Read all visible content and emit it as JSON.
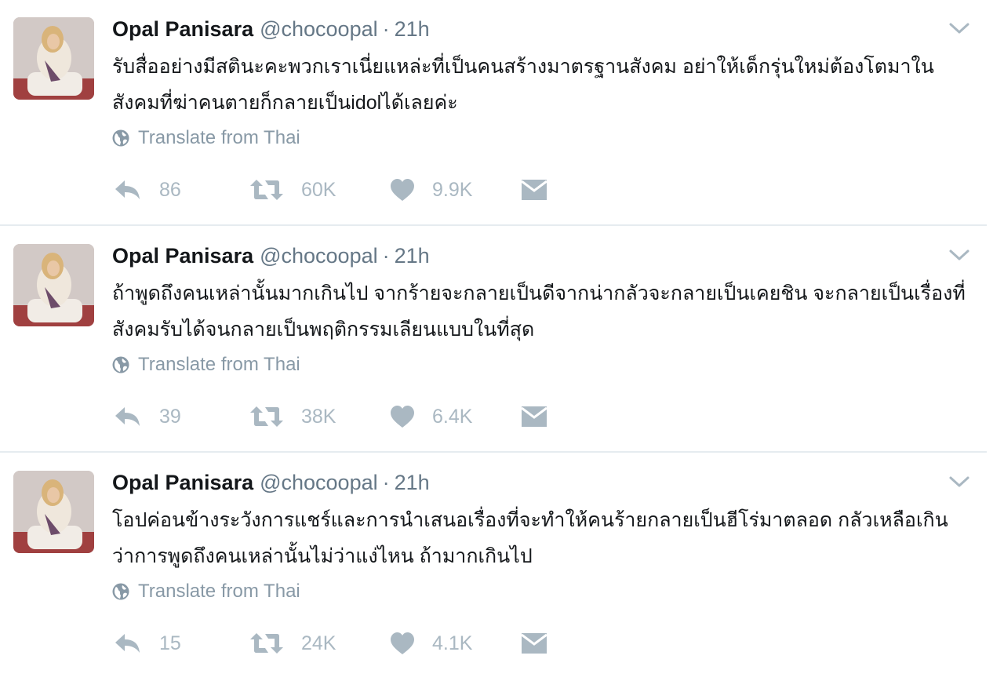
{
  "colors": {
    "name": "#14171a",
    "secondary": "#657786",
    "action_icon": "#aab8c2",
    "divider": "#e6ecf0"
  },
  "icons": {
    "reply": "reply-icon",
    "retweet": "retweet-icon",
    "like": "heart-icon",
    "dm": "envelope-icon",
    "translate": "globe-icon",
    "menu": "chevron-down-icon"
  },
  "tweets": [
    {
      "name": "Opal Panisara",
      "handle": "@chocoopal",
      "dot": "·",
      "time": "21h",
      "text": "รับสื่ออย่างมีสตินะคะพวกเราเนี่ยแหล่ะที่เป็นคนสร้างมาตรฐานสังคม อย่าให้เด็กรุ่นใหม่ต้องโตมาในสังคมที่ฆ่าคนตายก็กลายเป็นidolได้เลยค่ะ",
      "translate": "Translate from Thai",
      "replies": "86",
      "retweets": "60K",
      "likes": "9.9K"
    },
    {
      "name": "Opal Panisara",
      "handle": "@chocoopal",
      "dot": "·",
      "time": "21h",
      "text": "ถ้าพูดถึงคนเหล่านั้นมากเกินไป จากร้ายจะกลายเป็นดีจากน่ากลัวจะกลายเป็นเคยชิน จะกลายเป็นเรื่องที่สังคมรับได้จนกลายเป็นพฤติกรรมเลียนแบบในที่สุด",
      "translate": "Translate from Thai",
      "replies": "39",
      "retweets": "38K",
      "likes": "6.4K"
    },
    {
      "name": "Opal Panisara",
      "handle": "@chocoopal",
      "dot": "·",
      "time": "21h",
      "text": "โอปค่อนข้างระวังการแชร์และการนำเสนอเรื่องที่จะทำให้คนร้ายกลายเป็นฮีโร่มาตลอด กลัวเหลือเกินว่าการพูดถึงคนเหล่านั้นไม่ว่าแง่ไหน ถ้ามากเกินไป",
      "translate": "Translate from Thai",
      "replies": "15",
      "retweets": "24K",
      "likes": "4.1K"
    }
  ]
}
